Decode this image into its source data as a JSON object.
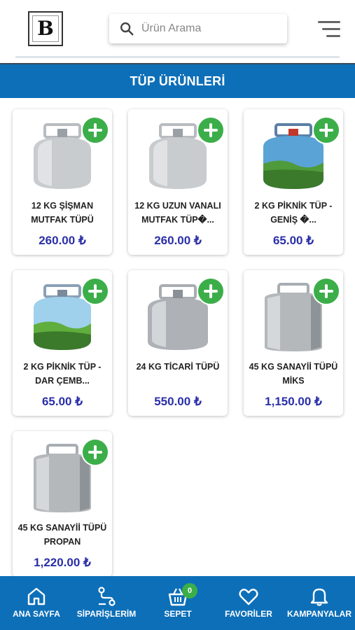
{
  "header": {
    "logo_letter": "B",
    "search_placeholder": "Ürün Arama"
  },
  "banner": {
    "title": "TÜP ÜRÜNLERİ"
  },
  "products": [
    {
      "name": "12 KG ŞİŞMAN MUTFAK TÜPÜ",
      "price": "260.00 ₺",
      "image": "plain-cylinder"
    },
    {
      "name": "12 KG UZUN VANALI MUTFAK TÜP�...",
      "price": "260.00 ₺",
      "image": "plain-cylinder"
    },
    {
      "name": "2 KG PİKNİK TÜP - GENİŞ �...",
      "price": "65.00 ₺",
      "image": "picnic-cylinder"
    },
    {
      "name": "2 KG PİKNİK TÜP - DAR ÇEMB...",
      "price": "65.00 ₺",
      "image": "picnic-cylinder"
    },
    {
      "name": "24 KG TİCARİ TÜPÜ",
      "price": "550.00 ₺",
      "image": "steel-cylinder"
    },
    {
      "name": "45 KG SANAYİİ TÜPÜ MİKS",
      "price": "1,150.00 ₺",
      "image": "industrial-cylinder"
    },
    {
      "name": "45 KG SANAYİİ TÜPÜ PROPAN",
      "price": "1,220.00 ₺",
      "image": "industrial-cylinder"
    }
  ],
  "nav": {
    "home": "ANA SAYFA",
    "orders": "SİPARİŞLERİM",
    "cart": "SEPET",
    "cart_count": "0",
    "favorites": "FAVORİLER",
    "campaigns": "KAMPANYALAR"
  },
  "colors": {
    "primary": "#0d6fb8",
    "add": "#3cae49",
    "price": "#2b2fa8"
  }
}
